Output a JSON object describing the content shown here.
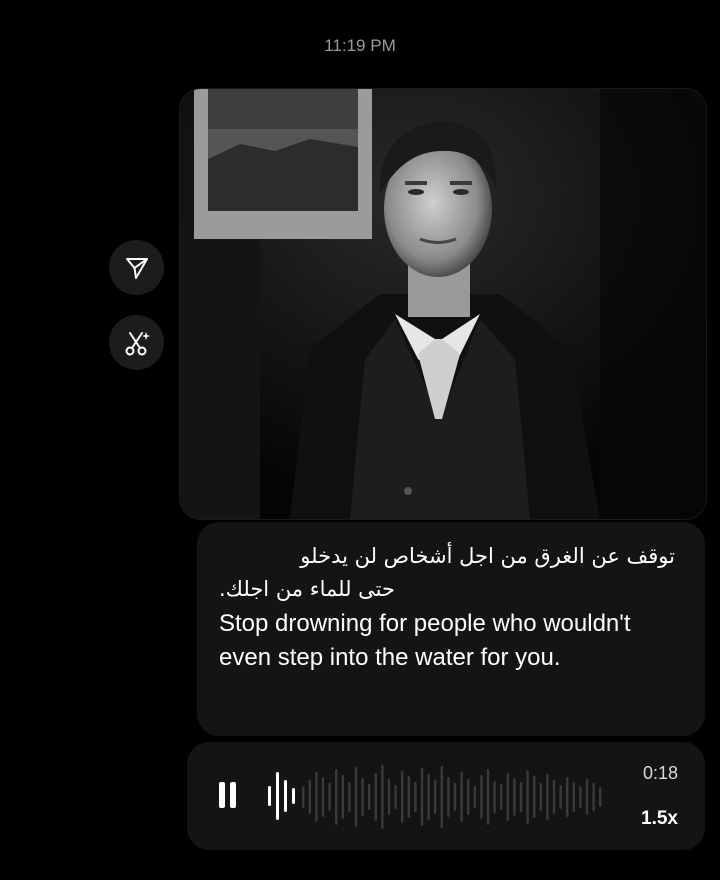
{
  "timestamp": "11:19 PM",
  "actions": {
    "share_icon": "paper-plane-icon",
    "edit_icon": "scissors-sparkle-icon"
  },
  "message": {
    "arabic_line1": "توقف عن الغرق من اجل أشخاص لن يدخلو",
    "arabic_line2": "حتى للماء من اجلك.",
    "english": "Stop drowning for people who wouldn't even step into the water for you."
  },
  "audio": {
    "state_icon": "pause-icon",
    "duration": "0:18",
    "speed": "1.5x"
  },
  "colors": {
    "background": "#000000",
    "bubble": "#141414",
    "button": "#1c1c1e",
    "timestamp": "#9a9a9a"
  }
}
